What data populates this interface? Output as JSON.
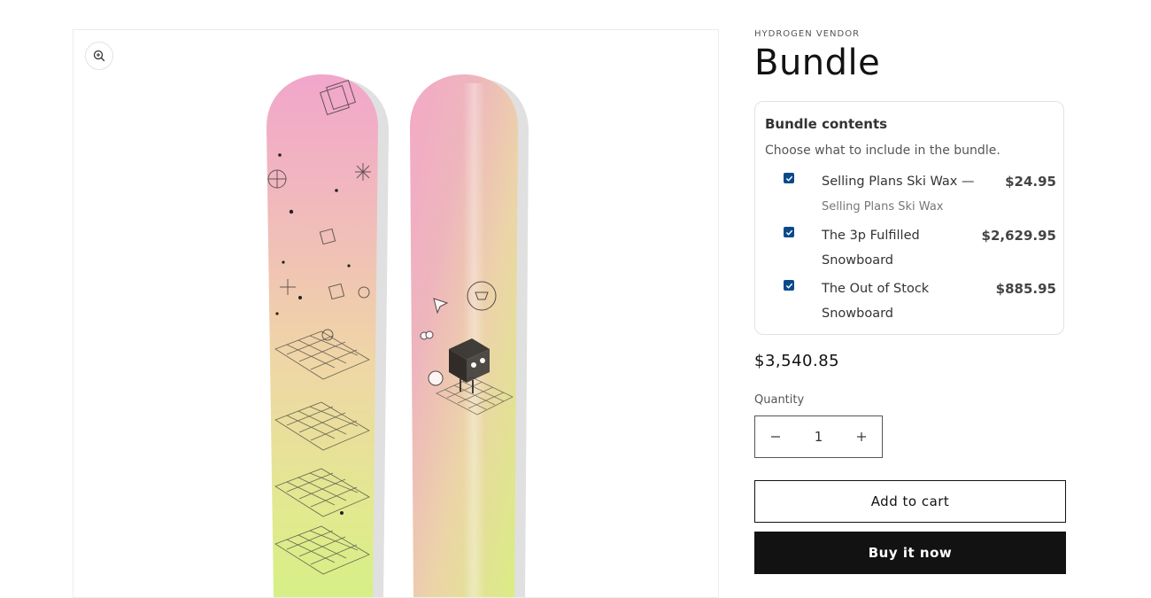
{
  "product": {
    "vendor": "HYDROGEN VENDOR",
    "title": "Bundle",
    "price": "$3,540.85"
  },
  "media": {
    "zoom_icon": "zoom-in-icon",
    "image_description_name": "snowboard-image"
  },
  "bundle": {
    "heading": "Bundle contents",
    "description": "Choose what to include in the bundle.",
    "items": [
      {
        "name": "Selling Plans Ski Wax —",
        "variant": "Selling Plans Ski Wax",
        "price": "$24.95",
        "checked": true
      },
      {
        "name": "The 3p Fulfilled Snowboard",
        "variant": "",
        "price": "$2,629.95",
        "checked": true
      },
      {
        "name": "The Out of Stock Snowboard",
        "variant": "",
        "price": "$885.95",
        "checked": true
      }
    ]
  },
  "quantity": {
    "label": "Quantity",
    "value": "1",
    "minus_icon": "minus-icon",
    "plus_icon": "plus-icon"
  },
  "buttons": {
    "add_to_cart": "Add to cart",
    "buy_now": "Buy it now"
  },
  "colors": {
    "accent": "#121212",
    "checkbox": "#0a4a8a"
  }
}
